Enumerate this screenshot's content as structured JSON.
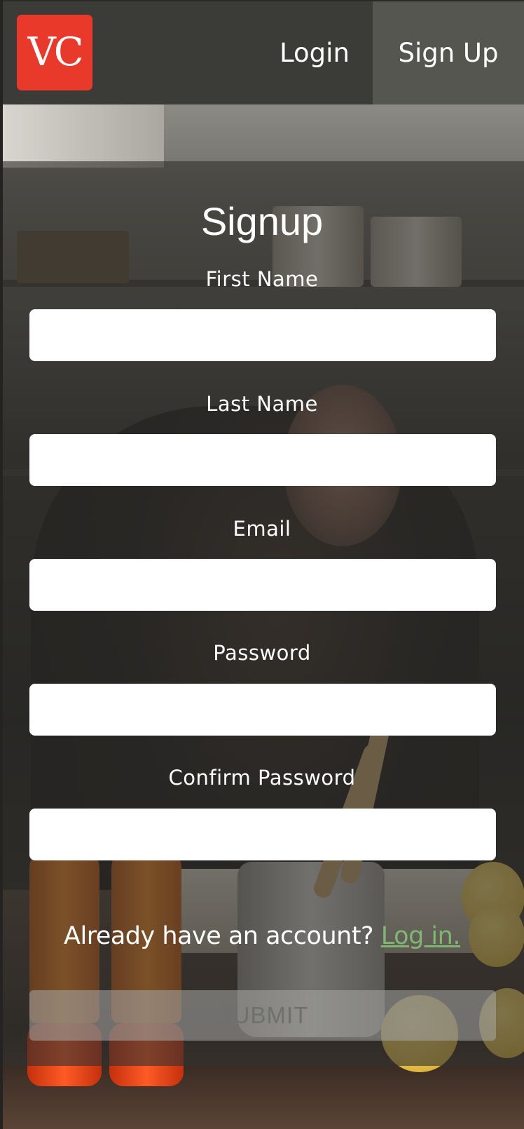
{
  "brand": {
    "logo_text": "VC",
    "logo_color": "#e8392a"
  },
  "nav": {
    "login_label": "Login",
    "signup_label": "Sign Up",
    "active_item": "Sign Up"
  },
  "form": {
    "title": "Signup",
    "fields": [
      {
        "label": "First Name",
        "value": "",
        "type": "text"
      },
      {
        "label": "Last Name",
        "value": "",
        "type": "text"
      },
      {
        "label": "Email",
        "value": "",
        "type": "email"
      },
      {
        "label": "Password",
        "value": "",
        "type": "password"
      },
      {
        "label": "Confirm Password",
        "value": "",
        "type": "password"
      }
    ],
    "account_prompt": "Already have an account?",
    "login_link": "Log in.",
    "submit_label": "SUBMIT"
  },
  "colors": {
    "navbar_bg": "#3b3b37",
    "active_nav_bg": "#55564f",
    "link_color": "#7fb673",
    "submit_bg": "#aaaaa8"
  }
}
